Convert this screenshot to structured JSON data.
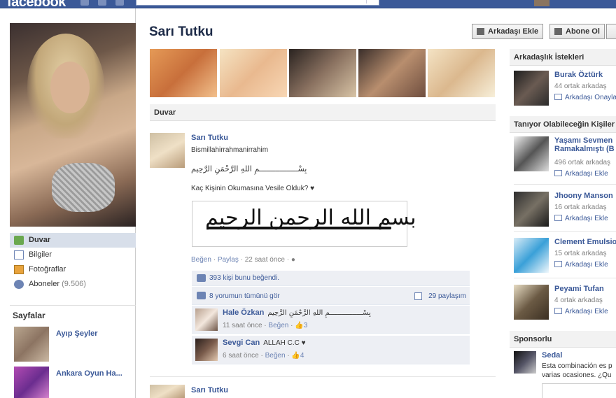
{
  "topbar": {
    "logo": "facebook"
  },
  "profile": {
    "name": "Sarı Tutku"
  },
  "header_buttons": {
    "add_friend": "Arkadaşı Ekle",
    "subscribe": "Abone Ol"
  },
  "nav": [
    {
      "label": "Duvar",
      "count": ""
    },
    {
      "label": "Bilgiler",
      "count": ""
    },
    {
      "label": "Fotoğraflar",
      "count": ""
    },
    {
      "label": "Aboneler",
      "count": "(9.506)"
    }
  ],
  "pages": {
    "title": "Sayfalar",
    "items": [
      {
        "name": "Ayıp Şeyler"
      },
      {
        "name": "Ankara Oyun Ha..."
      }
    ]
  },
  "wall": {
    "title": "Duvar"
  },
  "post": {
    "author": "Sarı Tutku",
    "line1": "Bismillahirrahmanirrahim",
    "line2": "بِسْـــــــــــــــــمِ اللهِ الرَّحْمَنِ الرَّحِيم",
    "line3": "Kaç Kişinin Okumasına Vesile Olduk? ♥",
    "image_text": "بسم الله الرحمن الرحيم",
    "like": "Beğen",
    "share": "Paylaş",
    "time": "22 saat önce",
    "likes_text": "393 kişi bunu beğendi.",
    "view_comments": "8 yorumun tümünü gör",
    "shares": "29 paylaşım"
  },
  "comments": [
    {
      "author": "Hale Özkan",
      "text": "بِسْــــــــــــــــمِ اللهِ الرَّحْمَنِ الرَّحِيم",
      "time": "11 saat önce",
      "like": "Beğen",
      "likes": "3"
    },
    {
      "author": "Sevgi Can",
      "text": "ALLAH C.C ♥",
      "time": "6 saat önce",
      "like": "Beğen",
      "likes": "4"
    }
  ],
  "post2": {
    "author": "Sarı Tutku"
  },
  "friend_requests": {
    "title": "Arkadaşlık İstekleri",
    "items": [
      {
        "name": "Burak Öztürk",
        "mutual": "44 ortak arkadaş",
        "action": "Arkadaşı Onayla"
      }
    ]
  },
  "people_you_may_know": {
    "title": "Tanıyor Olabileceğin Kişiler",
    "items": [
      {
        "name": "Yaşamı Sevmen",
        "name2": "Ramakalmıştı (B",
        "mutual": "496 ortak arkadaş",
        "action": "Arkadaşı Ekle"
      },
      {
        "name": "Jhoony Manson",
        "mutual": "16 ortak arkadaş",
        "action": "Arkadaşı Ekle"
      },
      {
        "name": "Clement Emulsio",
        "mutual": "15 ortak arkadaş",
        "action": "Arkadaşı Ekle"
      },
      {
        "name": "Peyami Tufan",
        "mutual": "4 ortak arkadaş",
        "action": "Arkadaşı Ekle"
      }
    ]
  },
  "sponsored": {
    "title": "Sponsorlu",
    "name": "Sedal",
    "text1": "Esta combinación es p",
    "text2": "varias ocasiones. ¿Qu"
  },
  "colors": {
    "brand": "#3b5998",
    "link": "#3b5998",
    "ufi_bg": "#edeff4"
  }
}
